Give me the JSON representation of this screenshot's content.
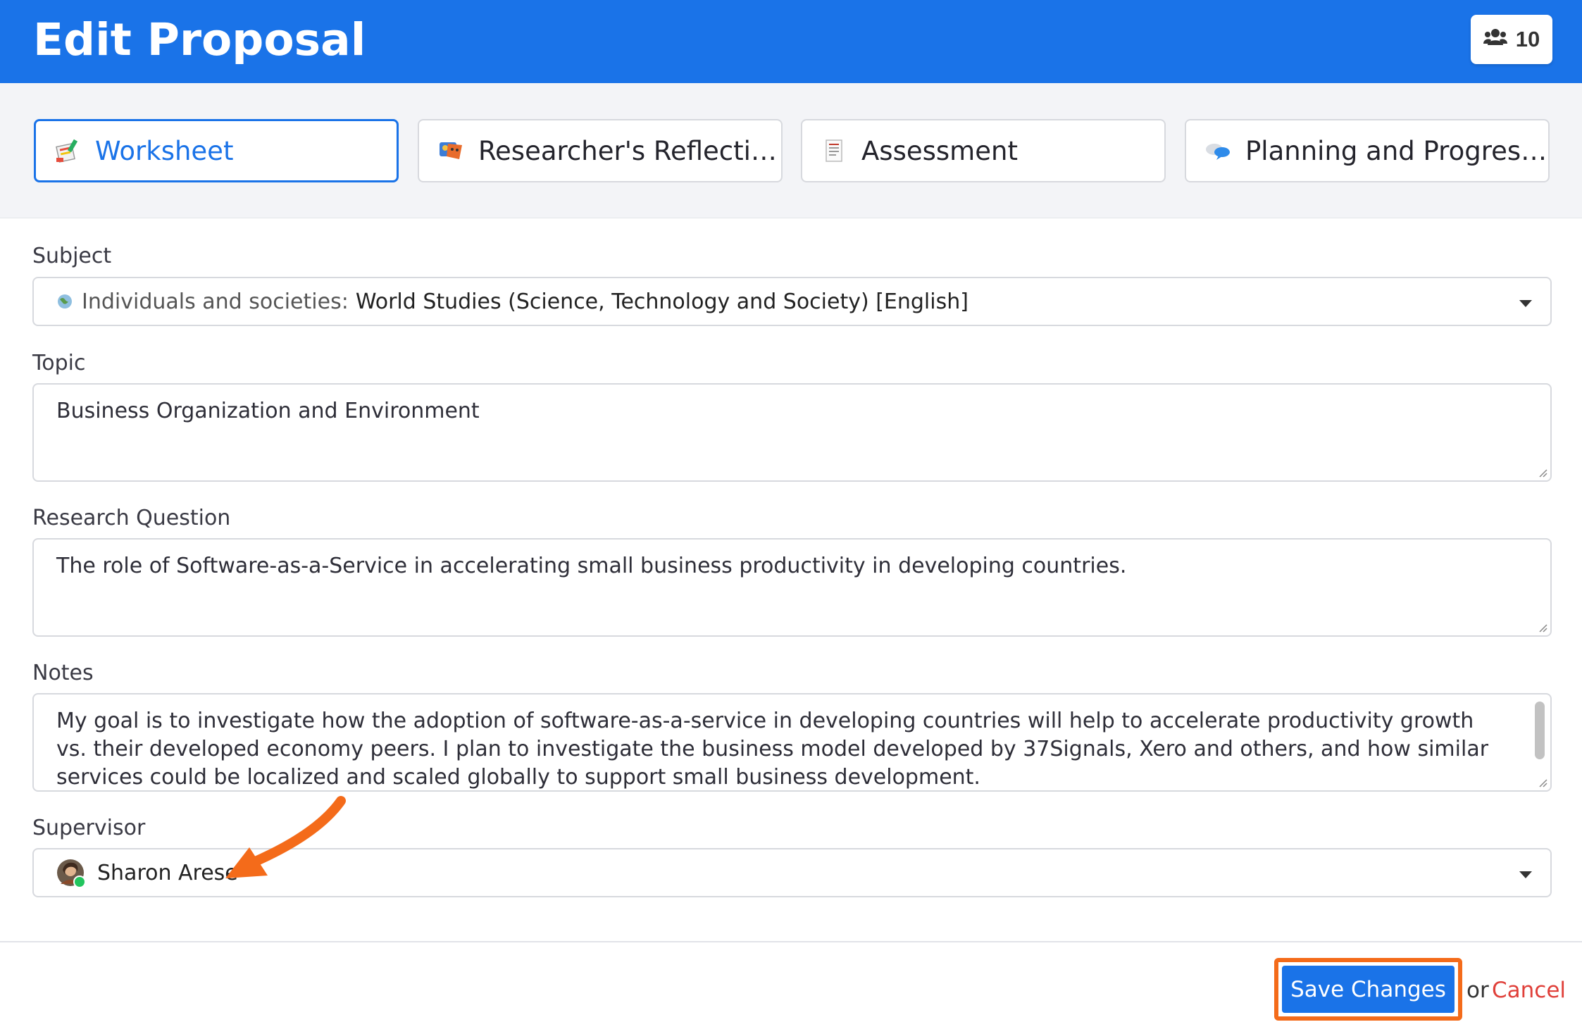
{
  "header": {
    "title": "Edit Proposal",
    "members_count": "10",
    "members_icon": "users-icon",
    "background": "#1a73e8"
  },
  "tabs": [
    {
      "label": "Worksheet",
      "icon": "worksheet-icon",
      "active": true
    },
    {
      "label": "Researcher's Reflection...",
      "icon": "reflection-icon",
      "active": false
    },
    {
      "label": "Assessment",
      "icon": "assessment-icon",
      "active": false
    },
    {
      "label": "Planning and Progress ...",
      "icon": "planning-icon",
      "active": false
    }
  ],
  "form": {
    "subject": {
      "label": "Subject",
      "category": "Individuals and societies:",
      "value": "World Studies (Science, Technology and Society) [English]"
    },
    "topic": {
      "label": "Topic",
      "value": "Business Organization and Environment"
    },
    "research_question": {
      "label": "Research Question",
      "value": "The role of Software-as-a-Service in accelerating small business productivity in developing countries."
    },
    "notes": {
      "label": "Notes",
      "value": "My goal is to investigate how the adoption of software-as-a-service in developing countries will help to accelerate productivity growth vs. their developed economy peers. I plan to investigate the business model developed by 37Signals, Xero and others, and how similar services could be localized and scaled globally to support small business development."
    },
    "supervisor": {
      "label": "Supervisor",
      "value": "Sharon Arese",
      "status": "online"
    }
  },
  "footer": {
    "save_label": "Save Changes",
    "or_text": "or",
    "cancel_label": "Cancel"
  },
  "colors": {
    "accent": "#1a73e8",
    "highlight": "#f46b1a",
    "cancel": "#e0403a",
    "online": "#22c55e"
  }
}
